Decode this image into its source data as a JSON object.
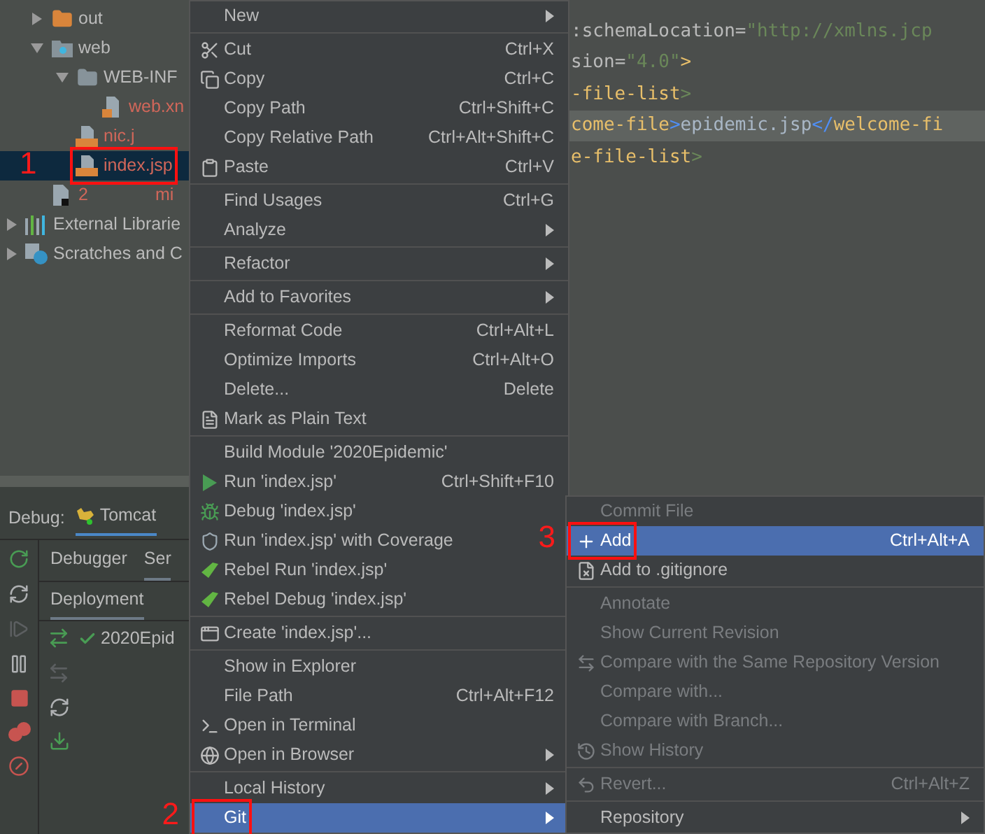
{
  "project_tree": [
    {
      "children": [
        {
          "kind": "excluded-folder",
          "label": "out",
          "expanded": false,
          "selected": false,
          "unversioned": false
        },
        {
          "kind": "web-folder",
          "label": "web",
          "expanded": true,
          "selected": false,
          "unversioned": false,
          "children": [
            {
              "kind": "folder",
              "label": "WEB-INF",
              "expanded": true,
              "selected": false,
              "unversioned": false,
              "children": [
                {
                  "kind": "xml",
                  "label": "web.xn",
                  "selected": false,
                  "unversioned": true
                }
              ]
            },
            {
              "kind": "jsp",
              "label": "nic.j",
              "selected": false,
              "unversioned": true
            },
            {
              "kind": "jsp",
              "label": "index.jsp",
              "selected": true,
              "unversioned": true,
              "annotation": "1"
            }
          ]
        },
        {
          "kind": "file",
          "label": "2",
          "suffix": "mi",
          "selected": false,
          "unversioned": true
        }
      ]
    },
    {
      "kind": "libraries",
      "label": "External Librarie",
      "expanded": false,
      "selected": false,
      "unversioned": false
    },
    {
      "kind": "scratches",
      "label": "Scratches and C",
      "expanded": false,
      "selected": false,
      "unversioned": false
    }
  ],
  "editor": {
    "lines": [
      {
        "current": false,
        "tokens": [
          {
            "kind": "attr",
            "text": ":schemaLocation"
          },
          {
            "kind": "attr",
            "text": "="
          },
          {
            "kind": "string",
            "text": "\"http://xmlns.jcp"
          }
        ]
      },
      {
        "current": false,
        "tokens": [
          {
            "kind": "attr",
            "text": "sion"
          },
          {
            "kind": "attr",
            "text": "="
          },
          {
            "kind": "string",
            "text": "\"4.0\""
          },
          {
            "kind": "tag",
            "text": ">"
          }
        ]
      },
      {
        "current": false,
        "tokens": [
          {
            "kind": "tag",
            "text": "-file-list"
          },
          {
            "kind": "bracket",
            "text": ">"
          }
        ]
      },
      {
        "current": true,
        "tokens": [
          {
            "kind": "tag",
            "text": "come-file"
          },
          {
            "kind": "match",
            "text": ">"
          },
          {
            "kind": "text",
            "text": "epidemic.jsp"
          },
          {
            "kind": "match",
            "text": "</"
          },
          {
            "kind": "tag",
            "text": "welcome-fi"
          }
        ]
      },
      {
        "current": false,
        "tokens": [
          {
            "kind": "tag",
            "text": "e-file-list"
          },
          {
            "kind": "bracket",
            "text": ">"
          }
        ]
      }
    ]
  },
  "debug_panel": {
    "title": "Debug:",
    "config_tab": {
      "label": "Tomcat",
      "selected": true
    },
    "toolbar": [
      {
        "disabled": false
      },
      {
        "disabled": false
      },
      {
        "disabled": true
      },
      {
        "disabled": false
      },
      {
        "disabled": false
      },
      {
        "disabled": false
      },
      {
        "disabled": false
      }
    ],
    "tabs": [
      {
        "label": "Debugger",
        "selected": false
      },
      {
        "label": "Ser",
        "selected": true
      }
    ],
    "sub_tabs": [
      {
        "label": "Deployment",
        "selected": true
      }
    ],
    "deploy_toolbar": [
      {
        "disabled": false
      },
      {
        "disabled": true
      },
      {
        "disabled": false
      },
      {
        "disabled": false
      }
    ],
    "deployments": [
      {
        "label": "2020Epid",
        "deployed": true
      }
    ]
  },
  "context_menu": {
    "groups": [
      {
        "items": [
          {
            "label": "New",
            "submenu": true,
            "selected": false
          }
        ]
      },
      {
        "items": [
          {
            "label": "Cut",
            "shortcut": "Ctrl+X",
            "submenu": false,
            "selected": false
          },
          {
            "label": "Copy",
            "shortcut": "Ctrl+C",
            "submenu": false,
            "selected": false
          },
          {
            "label": "Copy Path",
            "shortcut": "Ctrl+Shift+C",
            "submenu": false,
            "selected": false
          },
          {
            "label": "Copy Relative Path",
            "shortcut": "Ctrl+Alt+Shift+C",
            "submenu": false,
            "selected": false
          },
          {
            "label": "Paste",
            "shortcut": "Ctrl+V",
            "submenu": false,
            "selected": false
          }
        ]
      },
      {
        "items": [
          {
            "label": "Find Usages",
            "shortcut": "Ctrl+G",
            "submenu": false,
            "selected": false
          },
          {
            "label": "Analyze",
            "submenu": true,
            "selected": false
          }
        ]
      },
      {
        "items": [
          {
            "label": "Refactor",
            "submenu": true,
            "selected": false
          }
        ]
      },
      {
        "items": [
          {
            "label": "Add to Favorites",
            "submenu": true,
            "selected": false
          }
        ]
      },
      {
        "items": [
          {
            "label": "Reformat Code",
            "shortcut": "Ctrl+Alt+L",
            "submenu": false,
            "selected": false
          },
          {
            "label": "Optimize Imports",
            "shortcut": "Ctrl+Alt+O",
            "submenu": false,
            "selected": false
          },
          {
            "label": "Delete...",
            "shortcut": "Delete",
            "submenu": false,
            "selected": false
          },
          {
            "label": "Mark as Plain Text",
            "submenu": false,
            "selected": false
          }
        ]
      },
      {
        "items": [
          {
            "label": "Build Module '2020Epidemic'",
            "submenu": false,
            "selected": false
          },
          {
            "label": "Run 'index.jsp'",
            "shortcut": "Ctrl+Shift+F10",
            "submenu": false,
            "selected": false
          },
          {
            "label": "Debug 'index.jsp'",
            "submenu": false,
            "selected": false
          },
          {
            "label": "Run 'index.jsp' with Coverage",
            "submenu": false,
            "selected": false
          },
          {
            "label": "Rebel Run 'index.jsp'",
            "submenu": false,
            "selected": false
          },
          {
            "label": "Rebel Debug 'index.jsp'",
            "submenu": false,
            "selected": false
          }
        ]
      },
      {
        "items": [
          {
            "label": "Create 'index.jsp'...",
            "submenu": false,
            "selected": false
          }
        ]
      },
      {
        "items": [
          {
            "label": "Show in Explorer",
            "submenu": false,
            "selected": false
          },
          {
            "label": "File Path",
            "shortcut": "Ctrl+Alt+F12",
            "submenu": false,
            "selected": false
          },
          {
            "label": "Open in Terminal",
            "submenu": false,
            "selected": false
          },
          {
            "label": "Open in Browser",
            "submenu": true,
            "selected": false
          }
        ]
      },
      {
        "items": [
          {
            "label": "Local History",
            "submenu": true,
            "selected": false
          },
          {
            "label": "Git",
            "submenu": true,
            "selected": true,
            "annotation": "2"
          }
        ]
      }
    ]
  },
  "git_submenu": {
    "groups": [
      {
        "items": [
          {
            "label": "Commit File",
            "disabled": true,
            "submenu": false,
            "selected": false
          },
          {
            "label": "Add",
            "shortcut": "Ctrl+Alt+A",
            "disabled": false,
            "submenu": false,
            "selected": true,
            "annotation": "3"
          },
          {
            "label": "Add to .gitignore",
            "disabled": false,
            "submenu": false,
            "selected": false
          }
        ]
      },
      {
        "items": [
          {
            "label": "Annotate",
            "disabled": true,
            "submenu": false,
            "selected": false
          },
          {
            "label": "Show Current Revision",
            "disabled": true,
            "submenu": false,
            "selected": false
          },
          {
            "label": "Compare with the Same Repository Version",
            "disabled": true,
            "submenu": false,
            "selected": false
          },
          {
            "label": "Compare with...",
            "disabled": true,
            "submenu": false,
            "selected": false
          },
          {
            "label": "Compare with Branch...",
            "disabled": true,
            "submenu": false,
            "selected": false
          },
          {
            "label": "Show History",
            "disabled": true,
            "submenu": false,
            "selected": false
          }
        ]
      },
      {
        "items": [
          {
            "label": "Revert...",
            "shortcut": "Ctrl+Alt+Z",
            "disabled": true,
            "submenu": false,
            "selected": false
          }
        ]
      },
      {
        "items": [
          {
            "label": "Repository",
            "disabled": false,
            "submenu": true,
            "selected": false
          }
        ]
      }
    ]
  }
}
